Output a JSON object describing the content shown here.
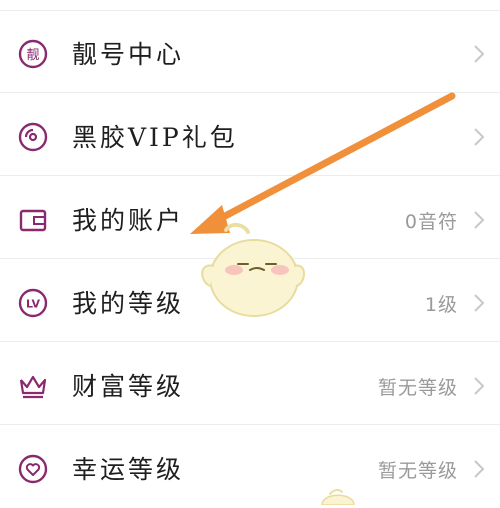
{
  "menu": {
    "items": [
      {
        "label": "靓号中心",
        "value": "",
        "icon": "pretty-number-icon"
      },
      {
        "label": "黑胶VIP礼包",
        "value": "",
        "icon": "vinyl-disc-icon"
      },
      {
        "label": "我的账户",
        "value": "0音符",
        "icon": "wallet-icon"
      },
      {
        "label": "我的等级",
        "value": "1级",
        "icon": "level-badge-icon"
      },
      {
        "label": "财富等级",
        "value": "暂无等级",
        "icon": "crown-icon"
      },
      {
        "label": "幸运等级",
        "value": "暂无等级",
        "icon": "heart-icon"
      }
    ]
  },
  "icons": {
    "pretty_number_glyph": "靓",
    "level_badge_text": "LV"
  },
  "colors": {
    "accent": "#8a2a6e",
    "arrow": "#f0903a",
    "text": "#1f1f1f",
    "muted": "#9a9a9a"
  }
}
